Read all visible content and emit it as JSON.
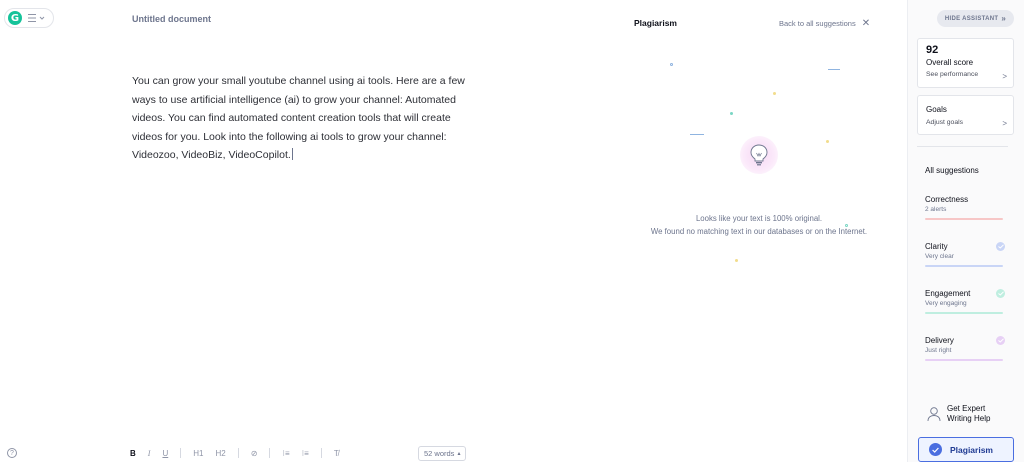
{
  "header": {
    "logo_letter": "G",
    "doc_title": "Untitled document"
  },
  "document": {
    "lines": [
      "You can grow your small youtube channel using ai tools. Here are a few",
      "ways to use artificial intelligence (ai) to grow your channel: Automated",
      "videos. You can find automated content creation tools that will create",
      "videos for you. Look into the following ai tools to grow your channel:",
      "Videozoo, VideoBiz, VideoCopilot."
    ]
  },
  "plagiarism_panel": {
    "title": "Plagiarism",
    "back_link": "Back to all suggestions",
    "close_glyph": "✕",
    "message_line1": "Looks like your text is 100% original.",
    "message_line2": "We found no matching text in our databases or on the Internet.",
    "icon": "lightbulb-icon"
  },
  "sidebar": {
    "hide_button": "HIDE ASSISTANT",
    "hide_glyph": "»",
    "score": {
      "value": "92",
      "label": "Overall score",
      "link": "See performance"
    },
    "goals": {
      "label": "Goals",
      "link": "Adjust goals"
    },
    "chevron": ">",
    "all_suggestions": "All suggestions",
    "categories": [
      {
        "name": "Correctness",
        "status": "2 alerts",
        "color": "#f08a8a",
        "checked": false
      },
      {
        "name": "Clarity",
        "status": "Very clear",
        "color": "#4a6ee0",
        "checked": true
      },
      {
        "name": "Engagement",
        "status": "Very engaging",
        "color": "#15c39a",
        "checked": true
      },
      {
        "name": "Delivery",
        "status": "Just right",
        "color": "#b36de0",
        "checked": true
      }
    ],
    "expert_line1": "Get Expert",
    "expert_line2": "Writing Help",
    "plagiarism_button": "Plagiarism"
  },
  "toolbar": {
    "bold": "B",
    "italic": "I",
    "underline": "U",
    "h1": "H1",
    "h2": "H2",
    "link_glyph": "⊘",
    "ordered_list": "⁝≡",
    "bullet_list": "⁝≡",
    "clear_format": "T̸",
    "word_count": "52 words",
    "word_count_glyph": "▴",
    "help": "?"
  }
}
